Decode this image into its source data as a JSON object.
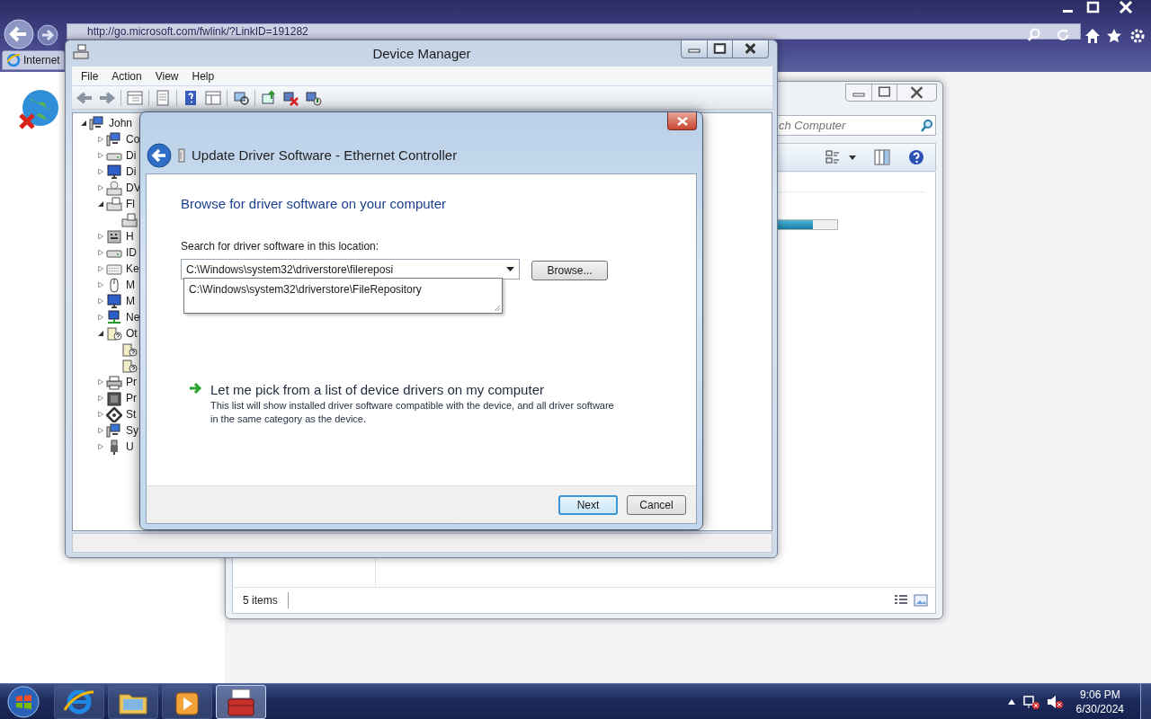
{
  "browser": {
    "address": "http://go.microsoft.com/fwlink/?LinkID=191282",
    "tab": "Internet"
  },
  "explorer": {
    "search_placeholder": "ch Computer",
    "drive_bar": {
      "level": 0.6
    },
    "status": "5 items"
  },
  "device_manager": {
    "title": "Device Manager",
    "menu": [
      "File",
      "Action",
      "View",
      "Help"
    ],
    "tree": {
      "label": "John",
      "kind": "computer",
      "expanded": true,
      "children": [
        {
          "label": "Co",
          "kind": "computer",
          "expanded": false
        },
        {
          "label": "Di",
          "kind": "drive",
          "expanded": false
        },
        {
          "label": "Di",
          "kind": "display",
          "expanded": false
        },
        {
          "label": "DV",
          "kind": "dvd",
          "expanded": false
        },
        {
          "label": "Fl",
          "kind": "floppy",
          "expanded": true,
          "children": [
            {
              "kind": "floppy"
            }
          ]
        },
        {
          "label": "H",
          "kind": "hid",
          "expanded": false
        },
        {
          "label": "ID",
          "kind": "drive",
          "expanded": false
        },
        {
          "label": "Ke",
          "kind": "keyboard",
          "expanded": false
        },
        {
          "label": "M",
          "kind": "mouse",
          "expanded": false
        },
        {
          "label": "M",
          "kind": "display",
          "expanded": false
        },
        {
          "label": "Ne",
          "kind": "network",
          "expanded": false
        },
        {
          "label": "Ot",
          "kind": "unknown",
          "expanded": true,
          "children": [
            {
              "kind": "unknown"
            },
            {
              "kind": "unknown"
            }
          ]
        },
        {
          "label": "Pr",
          "kind": "printer",
          "expanded": false
        },
        {
          "label": "Pr",
          "kind": "processor",
          "expanded": false
        },
        {
          "label": "St",
          "kind": "storage",
          "expanded": false
        },
        {
          "label": "Sy",
          "kind": "computer",
          "expanded": false
        },
        {
          "label": "U",
          "kind": "usb",
          "expanded": false
        }
      ]
    }
  },
  "dialog": {
    "title": "Update Driver Software - Ethernet Controller",
    "heading": "Browse for driver software on your computer",
    "field_label": "Search for driver software in this location:",
    "path": "C:\\Windows\\system32\\driverstore\\filereposi",
    "suggestions": [
      "C:\\Windows\\system32\\driverstore\\FileRepository"
    ],
    "browse": "Browse...",
    "pick_link": "Let me pick from a list of device drivers on my computer",
    "pick_description": "This list will show installed driver software compatible with the device, and all driver software in the same category as the device.",
    "buttons": [
      {
        "label": "Next",
        "default": true
      },
      {
        "label": "Cancel",
        "default": false
      }
    ]
  },
  "taskbar": {
    "apps": [
      {
        "kind": "ie",
        "selected": false
      },
      {
        "kind": "folder",
        "selected": false
      },
      {
        "kind": "media",
        "selected": false
      },
      {
        "kind": "toolbox",
        "selected": true
      }
    ],
    "time": "9:06 PM",
    "date": "6/30/2024"
  }
}
